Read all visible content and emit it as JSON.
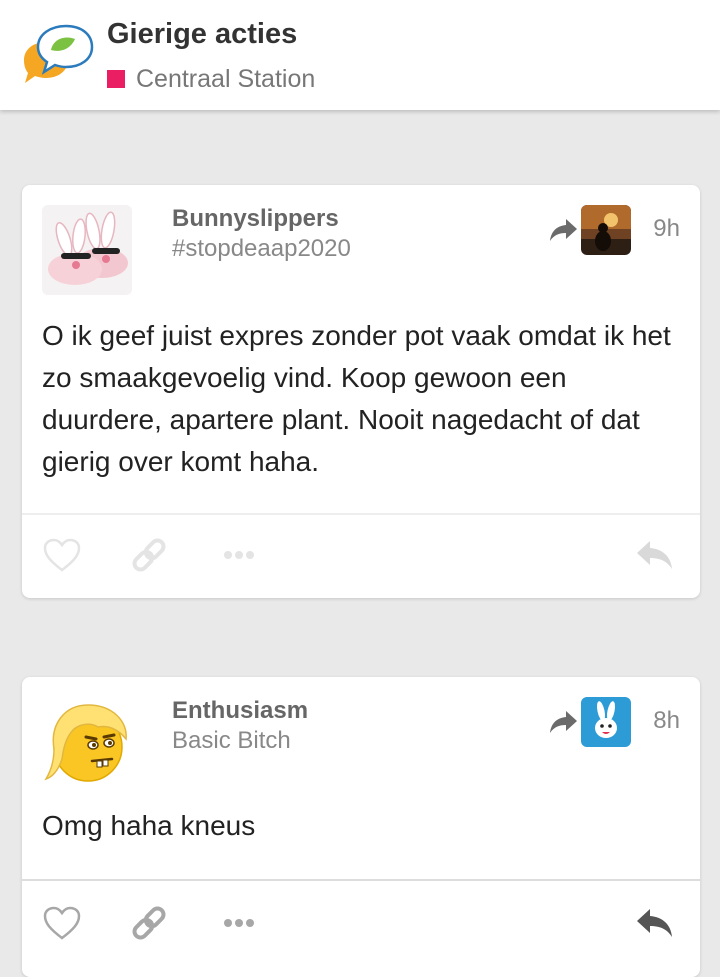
{
  "header": {
    "title": "Gierige acties",
    "subtitle": "Centraal Station",
    "accent_color": "#e91e63",
    "logo_icon": "chat-bubbles-logo"
  },
  "posts": [
    {
      "username": "Bunnyslippers",
      "tag": "#stopdeaap2020",
      "time": "9h",
      "text": "O ik geef juist expres zonder pot vaak omdat ik het zo smaakgevoelig vind. Koop gewoon een duurdere, apartere plant. Nooit nagedacht of dat gierig over komt haha.",
      "avatar_icon": "bunny-slippers-avatar",
      "group_icon": "sunset-silhouette-thumbnail"
    },
    {
      "username": "Enthusiasm",
      "tag": "Basic Bitch",
      "time": "8h",
      "text": "Omg haha kneus",
      "avatar_icon": "blonde-emoji-avatar",
      "group_icon": "rabbit-thumbnail"
    }
  ],
  "actions": {
    "like_icon": "heart-icon",
    "link_icon": "link-icon",
    "more_icon": "more-icon",
    "reply_icon": "reply-icon"
  }
}
